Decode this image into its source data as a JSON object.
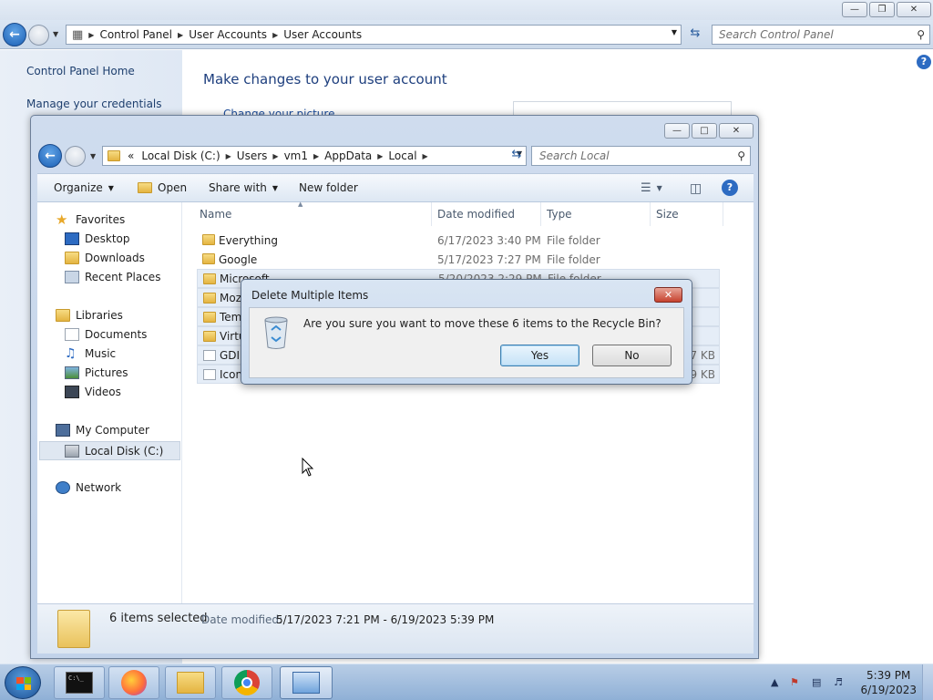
{
  "cp": {
    "breadcrumb": [
      "Control Panel",
      "User Accounts",
      "User Accounts"
    ],
    "search_placeholder": "Search Control Panel",
    "left_links": [
      "Control Panel Home",
      "Manage your credentials"
    ],
    "main_title": "Make changes to your user account",
    "main_link": "Change your picture"
  },
  "explorer": {
    "breadcrumb": [
      "Local Disk (C:)",
      "Users",
      "vm1",
      "AppData",
      "Local"
    ],
    "breadcrumb_prefix": "«",
    "search_placeholder": "Search Local",
    "toolbar": {
      "organize": "Organize",
      "open": "Open",
      "share_with": "Share with",
      "new_folder": "New folder"
    },
    "tree": {
      "favorites": "Favorites",
      "desktop": "Desktop",
      "downloads": "Downloads",
      "recent_places": "Recent Places",
      "libraries": "Libraries",
      "documents": "Documents",
      "music": "Music",
      "pictures": "Pictures",
      "videos": "Videos",
      "my_computer": "My Computer",
      "local_disk": "Local Disk (C:)",
      "network": "Network"
    },
    "columns": {
      "name": "Name",
      "date": "Date modified",
      "type": "Type",
      "size": "Size"
    },
    "rows": [
      {
        "name": "Everything",
        "date": "6/17/2023 3:40 PM",
        "type": "File folder",
        "size": ""
      },
      {
        "name": "Google",
        "date": "5/17/2023 7:27 PM",
        "type": "File folder",
        "size": ""
      },
      {
        "name": "Microsoft",
        "date": "5/20/2023 2:29 PM",
        "type": "File folder",
        "size": ""
      },
      {
        "name": "Mozi",
        "date": "",
        "type": "",
        "size": ""
      },
      {
        "name": "Temp",
        "date": "",
        "type": "",
        "size": ""
      },
      {
        "name": "Virtu",
        "date": "",
        "type": "",
        "size": ""
      },
      {
        "name": "GDIP",
        "date": "",
        "type": "",
        "size": "57 KB"
      },
      {
        "name": "Iconc",
        "date": "",
        "type": "",
        "size": "39 KB"
      }
    ],
    "status": {
      "count": "6 items selected",
      "date_label": "Date modified:",
      "date_value": "5/17/2023 7:21 PM - 6/19/2023 5:39 PM"
    }
  },
  "dialog": {
    "title": "Delete Multiple Items",
    "message": "Are you sure you want to move these 6 items to the Recycle Bin?",
    "yes": "Yes",
    "no": "No"
  },
  "taskbar": {
    "time": "5:39 PM",
    "date": "6/19/2023",
    "apps": [
      "cmd-icon",
      "firefox-icon",
      "file-explorer-icon",
      "chrome-icon",
      "control-panel-icon"
    ]
  },
  "colors": {
    "accent": "#2d6bc2",
    "title_blue": "#1e3f7e",
    "selection": "#e5edf7",
    "dialog_close": "#c6422e"
  }
}
